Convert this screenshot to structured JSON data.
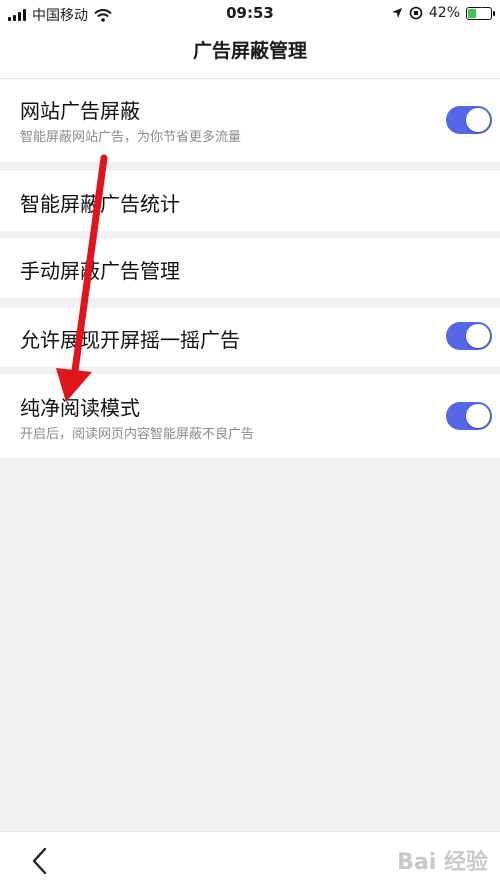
{
  "status_bar": {
    "carrier": "中国移动",
    "time": "09:53",
    "battery_percent": "42%",
    "battery_level": 0.42
  },
  "nav": {
    "title": "广告屏蔽管理"
  },
  "settings": {
    "site_ad_block": {
      "title": "网站广告屏蔽",
      "subtitle": "智能屏蔽网站广告，为你节省更多流量",
      "enabled": true
    },
    "ad_stats": {
      "title": "智能屏蔽广告统计"
    },
    "manual_block": {
      "title": "手动屏蔽广告管理"
    },
    "shake_ads": {
      "title": "允许展现开屏摇一摇广告",
      "enabled": true
    },
    "pure_reading": {
      "title": "纯净阅读模式",
      "subtitle": "开启后，阅读网页内容智能屏蔽不良广告",
      "enabled": true
    }
  },
  "watermark": "Bai 经验",
  "colors": {
    "toggle_on": "#5566e8",
    "annotation_arrow": "#e0141b",
    "background": "#f2f2f4"
  }
}
